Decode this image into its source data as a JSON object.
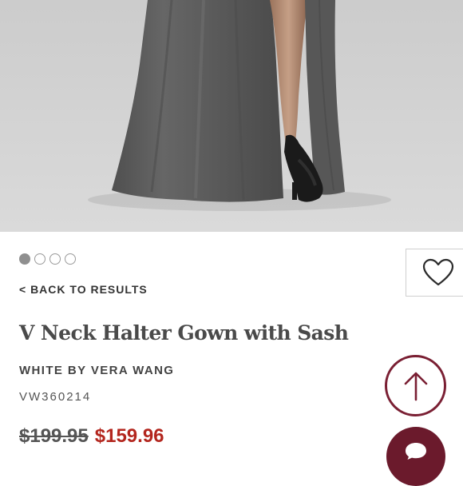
{
  "hero": {
    "image_alt": "Model wearing charcoal gray chiffon gown with side slit and black strappy heels",
    "background_color": "#cdcdcd",
    "dress_color": "#5e5e5e"
  },
  "carousel": {
    "total": 4,
    "active_index": 0
  },
  "nav": {
    "back_label": "< BACK TO RESULTS"
  },
  "favorite": {
    "icon": "heart-icon"
  },
  "product": {
    "title": "V Neck Halter Gown with Sash",
    "brand": "WHITE BY VERA WANG",
    "sku": "VW360214",
    "original_price": "$199.95",
    "sale_price": "$159.96"
  },
  "colors": {
    "sale": "#b3261e",
    "accent": "#7a1f33"
  },
  "actions": {
    "scroll_top_icon": "arrow-up-icon",
    "chat_icon": "chat-icon"
  }
}
